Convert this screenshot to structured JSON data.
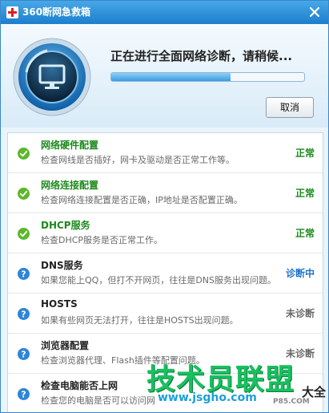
{
  "window": {
    "title": "360断网急救箱",
    "colors": {
      "titlebar": "#2b8fd8",
      "normal": "#1a8a1a",
      "active": "#1e73c8",
      "pending": "#666666"
    }
  },
  "header": {
    "status": "正在进行全面网络诊断，请稍候...",
    "progress": 0.62,
    "cancel_label": "取消"
  },
  "rows": [
    {
      "title": "网络硬件配置",
      "desc": "检查网线是否插好，网卡及驱动是否正常工作等。",
      "status": "正常",
      "icon": "check-icon"
    },
    {
      "title": "网络连接配置",
      "desc": "检查网络连接配置是否正确，IP地址是否配置正确。",
      "status": "正常",
      "icon": "check-icon"
    },
    {
      "title": "DHCP服务",
      "desc": "检查DHCP服务是否正常工作。",
      "status": "正常",
      "icon": "check-icon"
    },
    {
      "title": "DNS服务",
      "desc": "如果您能上QQ，但打不开网页，往往是DNS服务出现问题。",
      "status": "诊断中",
      "icon": "question-icon"
    },
    {
      "title": "HOSTS",
      "desc": "如果有些网页无法打开，往往是HOSTS出现问题。",
      "status": "未诊断",
      "icon": "question-icon"
    },
    {
      "title": "浏览器配置",
      "desc": "检查浏览器代理、Flash插件等配置问题。",
      "status": "未诊断",
      "icon": "question-icon"
    },
    {
      "title": "检查电脑能否上网",
      "desc": "检查您的电脑是否可以访问网",
      "status": "",
      "icon": "question-icon"
    }
  ],
  "watermark": {
    "main": "技术员联盟",
    "url": "www.jsgho.com",
    "side": "大全",
    "side_small": "P85.COM"
  }
}
